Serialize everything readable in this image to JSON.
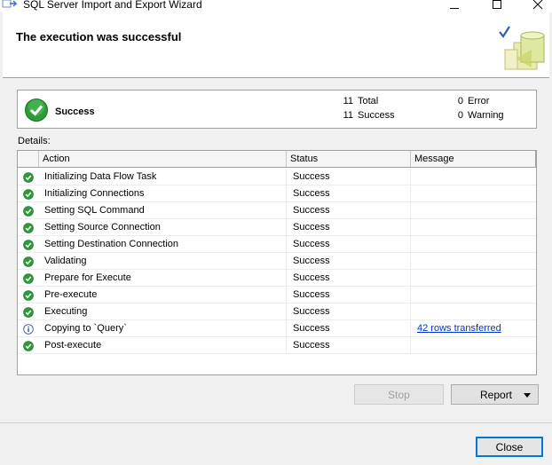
{
  "window": {
    "title": "SQL Server Import and Export Wizard",
    "app_icon": "wizard-app-icon"
  },
  "header": {
    "title": "The execution was successful",
    "art_icon": "database-checkmark-icon"
  },
  "summary": {
    "status_label": "Success",
    "status_icon": "success-check-icon",
    "total": {
      "count": "11",
      "label": "Total"
    },
    "success": {
      "count": "11",
      "label": "Success"
    },
    "error": {
      "count": "0",
      "label": "Error"
    },
    "warning": {
      "count": "0",
      "label": "Warning"
    }
  },
  "details": {
    "label": "Details:",
    "columns": {
      "action": "Action",
      "status": "Status",
      "message": "Message"
    },
    "rows": [
      {
        "icon": "success-check-icon",
        "action": "Initializing Data Flow Task",
        "status": "Success",
        "message": ""
      },
      {
        "icon": "success-check-icon",
        "action": "Initializing Connections",
        "status": "Success",
        "message": ""
      },
      {
        "icon": "success-check-icon",
        "action": "Setting SQL Command",
        "status": "Success",
        "message": ""
      },
      {
        "icon": "success-check-icon",
        "action": "Setting Source Connection",
        "status": "Success",
        "message": ""
      },
      {
        "icon": "success-check-icon",
        "action": "Setting Destination Connection",
        "status": "Success",
        "message": ""
      },
      {
        "icon": "success-check-icon",
        "action": "Validating",
        "status": "Success",
        "message": ""
      },
      {
        "icon": "success-check-icon",
        "action": "Prepare for Execute",
        "status": "Success",
        "message": ""
      },
      {
        "icon": "success-check-icon",
        "action": "Pre-execute",
        "status": "Success",
        "message": ""
      },
      {
        "icon": "success-check-icon",
        "action": "Executing",
        "status": "Success",
        "message": ""
      },
      {
        "icon": "info-icon",
        "action": "Copying to `Query`",
        "status": "Success",
        "message": "42 rows transferred"
      },
      {
        "icon": "success-check-icon",
        "action": "Post-execute",
        "status": "Success",
        "message": ""
      }
    ]
  },
  "buttons": {
    "stop": "Stop",
    "report": "Report",
    "close": "Close"
  },
  "colors": {
    "success_green": "#2e9a3a",
    "link_blue": "#0033cc",
    "focus_blue": "#0078d7"
  }
}
